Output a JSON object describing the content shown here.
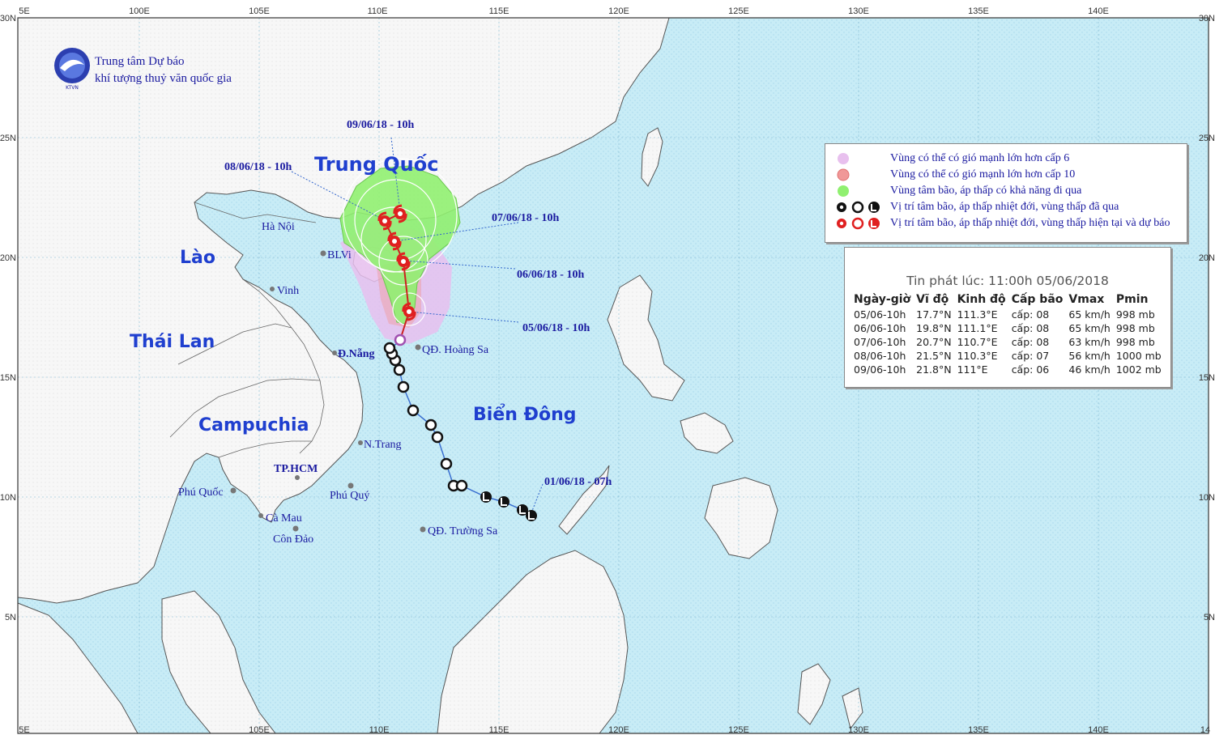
{
  "agency": {
    "line1": "Trung tâm Dự báo",
    "line2": "khí tượng thuỷ văn quốc gia",
    "logo_text": "KTVN"
  },
  "axes": {
    "top_lon_labels": [
      "5E",
      "100E",
      "105E",
      "110E",
      "115E",
      "120E",
      "125E",
      "130E",
      "135E",
      "140E"
    ],
    "bottom_lon_labels": [
      "5E",
      "105E",
      "110E",
      "115E",
      "120E",
      "125E",
      "130E",
      "135E",
      "140E",
      "14"
    ],
    "left_lat_labels": [
      "30N",
      "25N",
      "20N",
      "15N",
      "10N",
      "5N"
    ],
    "right_lat_labels": [
      "30N",
      "25N",
      "20N",
      "15N",
      "10N",
      "5N"
    ]
  },
  "regions": {
    "china": "Trung Quốc",
    "laos": "Lào",
    "thailand": "Thái Lan",
    "cambodia": "Campuchia",
    "east_sea": "Biển Đông"
  },
  "places": [
    {
      "id": "hanoi",
      "name": "Hà Nội"
    },
    {
      "id": "bachlongvi",
      "name": "BLVi"
    },
    {
      "id": "vinh",
      "name": "Vinh"
    },
    {
      "id": "danang",
      "name": "Đ.Nẵng"
    },
    {
      "id": "hoangsa",
      "name": "QĐ. Hoàng Sa"
    },
    {
      "id": "nhatrang",
      "name": "N.Trang"
    },
    {
      "id": "hcm",
      "name": "TP.HCM"
    },
    {
      "id": "phuquoc",
      "name": "Phú Quốc"
    },
    {
      "id": "phuquy",
      "name": "Phú Quý"
    },
    {
      "id": "camau",
      "name": "Cà Mau"
    },
    {
      "id": "condao",
      "name": "Côn Đảo"
    },
    {
      "id": "truongsa",
      "name": "QĐ. Trường Sa"
    }
  ],
  "track_labels": {
    "t0906": "09/06/18 - 10h",
    "t0806": "08/06/18 - 10h",
    "t0706": "07/06/18 - 10h",
    "t0606": "06/06/18 - 10h",
    "t0506": "05/06/18 - 10h",
    "t0106": "01/06/18 - 07h"
  },
  "legend": {
    "items": [
      {
        "label": "Vùng có thể có gió mạnh lớn hơn cấp 6",
        "color": "#e8c0ee"
      },
      {
        "label": "Vùng có thể có gió mạnh lớn hơn cấp 10",
        "color": "#f09898"
      },
      {
        "label": "Vùng tâm bão, áp thấp có khả năng đi qua",
        "color": "#90f070"
      },
      {
        "label": "Vị trí tâm bão, áp thấp nhiệt đới, vùng thấp đã qua",
        "color": "#111111"
      },
      {
        "label": "Vị trí tâm bão, áp thấp nhiệt đới, vùng thấp hiện tại và dự báo",
        "color": "#e02020"
      }
    ]
  },
  "bulletin": {
    "issued": "Tin phát lúc: 11:00h 05/06/2018",
    "headers": [
      "Ngày-giờ",
      "Vĩ độ",
      "Kinh độ",
      "Cấp bão",
      "Vmax",
      "Pmin"
    ],
    "rows": [
      [
        "05/06-10h",
        "17.7°N",
        "111.3°E",
        "cấp: 08",
        "65 km/h",
        "998 mb"
      ],
      [
        "06/06-10h",
        "19.8°N",
        "111.1°E",
        "cấp: 08",
        "65 km/h",
        "998 mb"
      ],
      [
        "07/06-10h",
        "20.7°N",
        "110.7°E",
        "cấp: 08",
        "63 km/h",
        "998 mb"
      ],
      [
        "08/06-10h",
        "21.5°N",
        "110.3°E",
        "cấp: 07",
        "56 km/h",
        "1000 mb"
      ],
      [
        "09/06-10h",
        "21.8°N",
        "111°E",
        "cấp: 06",
        "46 km/h",
        "1002 mb"
      ]
    ]
  },
  "colors": {
    "sea": "#c8ecf6",
    "land": "#f6f6f6",
    "wind6": "#e8c0ee",
    "wind10": "#f09898",
    "cone": "#90f070",
    "label_blue": "#1a1aa0",
    "region_blue": "#1f3fcf"
  }
}
